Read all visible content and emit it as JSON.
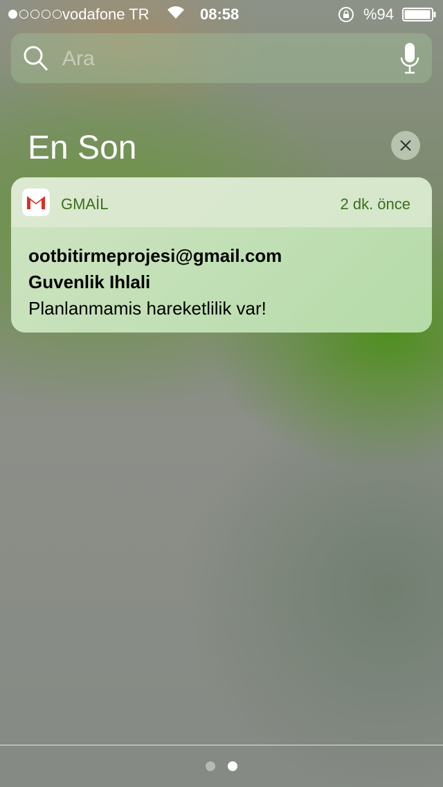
{
  "status_bar": {
    "signal_strength": 1,
    "signal_max": 5,
    "carrier": "vodafone TR",
    "time": "08:58",
    "battery": "%94",
    "battery_level": 0.94
  },
  "search": {
    "placeholder": "Ara"
  },
  "section": {
    "title": "En Son"
  },
  "notification": {
    "app": "GMAİL",
    "time": "2 dk. önce",
    "sender": "ootbitirmeprojesi@gmail.com",
    "subject": "Guvenlik Ihlali",
    "message": "Planlanmamis hareketlilik var!"
  },
  "pager": {
    "pages": 2,
    "current": 2
  }
}
